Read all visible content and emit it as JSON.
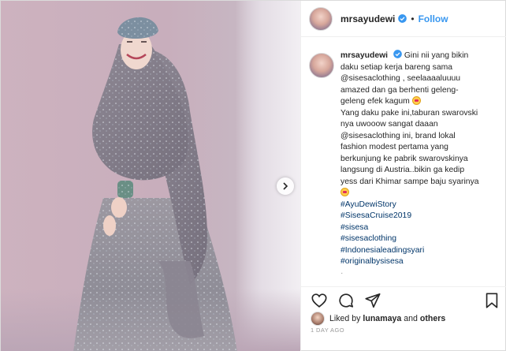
{
  "header": {
    "username": "mrsayudewi",
    "dot": "•",
    "follow_label": "Follow"
  },
  "caption": {
    "username": "mrsayudewi",
    "lines": [
      "Gini nii yang bikin",
      "daku setiap kerja bareng sama",
      "@sisesaclothing , seelaaaaluuuu",
      "amazed dan ga berhenti geleng-",
      "geleng efek kagum",
      "Yang daku pake ini,taburan swarovski",
      "nya uwooow sangat daaan",
      "@sisesaclothing ini, brand lokal",
      "fashion modest pertama yang",
      "berkunjung ke pabrik swarovskinya",
      "langsung di Austria..bikin ga kedip",
      "yess dari Khimar sampe baju syarinya"
    ],
    "hashtags": [
      "#AyuDewiStory",
      "#SisesaCruise2019",
      "#sisesa",
      "#sisesaclothing",
      "#Indonesialeadingsyari",
      "#originalbysisesa"
    ],
    "more": "·"
  },
  "likes": {
    "prefix": "Liked by",
    "user": "lunamaya",
    "middle": "and",
    "others": "others"
  },
  "timestamp": "1 DAY AGO",
  "icons": {
    "like": "heart-icon",
    "comment": "comment-icon",
    "share": "share-icon",
    "save": "bookmark-icon",
    "next": "chevron-right-icon",
    "verified": "verified-badge-icon"
  },
  "colors": {
    "link": "#003569",
    "follow": "#3897f0",
    "verified": "#3897f0",
    "muted": "#999999"
  }
}
